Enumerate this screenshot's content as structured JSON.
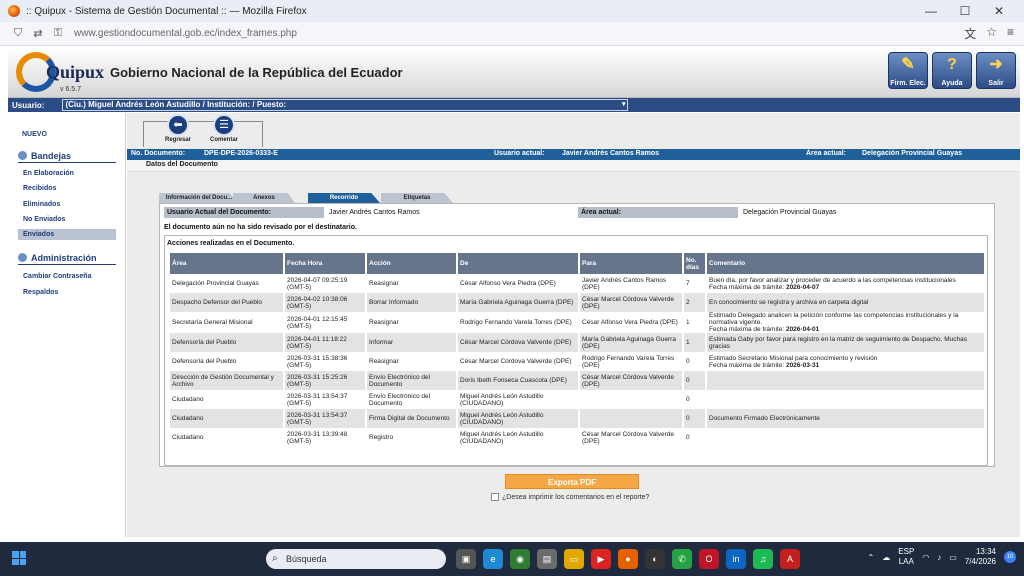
{
  "browser": {
    "title": ":: Quipux - Sistema de Gestión Documental :: — Mozilla Firefox",
    "url": "www.gestiondocumental.gob.ec/index_frames.php"
  },
  "header": {
    "logo_text": "Quipux",
    "version": "v 6.5.7",
    "gov_title": "Gobierno Nacional de la República del Ecuador",
    "buttons": [
      "Firm. Elec.",
      "Ayuda",
      "Salir"
    ]
  },
  "userbar": {
    "label": "Usuario:",
    "value": "(Ciu.) Miguel Andrés León Astudillo / Institución: / Puesto:"
  },
  "sidebar": {
    "nuevo": "NUEVO",
    "bandejas": "Bandejas",
    "items": [
      "En Elaboración",
      "Recibidos",
      "Eliminados",
      "No Enviados",
      "Enviados"
    ],
    "administracion": "Administración",
    "admin_items": [
      "Cambiar Contraseña",
      "Respaldos"
    ]
  },
  "toolbar": {
    "regresar": "Regresar",
    "comentar": "Comentar"
  },
  "infobar": {
    "doc_label": "No. Documento:",
    "doc_value": "DPE-DPE-2026-0333-E",
    "user_label": "Usuario actual:",
    "user_value": "Javier Andrés Cantos Ramos",
    "area_label": "Área actual:",
    "area_value": "Delegación Provincial Guayas"
  },
  "datos_title": "Datos del Documento",
  "tabs": [
    "Información del Docu...",
    "Anexos",
    "Recorrido",
    "Etiquetas"
  ],
  "current": {
    "user_label": "Usuario Actual del Documento:",
    "user_value": "Javier Andrés Cantos Ramos",
    "area_label": "Área actual:",
    "area_value": "Delegación Provincial Guayas"
  },
  "not_reviewed": "El documento aún no ha sido revisado por el destinatario.",
  "actions_title": "Acciones realizadas en el Documento.",
  "columns": [
    "Área",
    "Fecha Hora",
    "Acción",
    "De",
    "Para",
    "No. días",
    "Comentario"
  ],
  "rows": [
    [
      "Delegación Provincial Guayas",
      "2026-04-07 09:25:19 (GMT-5)",
      "Reasignar",
      "César Alfonso Vera Piedra (DPE)",
      "Javier Andrés Cantos Ramos (DPE)",
      "7",
      "Buen día, por favor analizar y proceder de acuerdo a las competencias institucionales",
      "Fecha máxima de trámite: ",
      "2026-04-07"
    ],
    [
      "Despacho Defensor del Pueblo",
      "2026-04-02 10:38:06 (GMT-5)",
      "Borrar Informado",
      "María Gabriela Aguinaga Guerra (DPE)",
      "César Marcel Córdova Valverde (DPE)",
      "2",
      "En conocimiento se registra y archiva en carpeta digital",
      "",
      ""
    ],
    [
      "Secretaría General Misional",
      "2026-04-01 12:15:45 (GMT-5)",
      "Reasignar",
      "Rodrigo Fernando Varela Torres (DPE)",
      "César Alfonso Vera Piedra (DPE)",
      "1",
      "Estimado Delegado analicen la petición conforme las competencias institucionales y la normativa vigente.",
      "Fecha máxima de trámite: ",
      "2026-04-01"
    ],
    [
      "Defensoría del Pueblo",
      "2026-04-01 11:18:22 (GMT-5)",
      "Informar",
      "César Marcel Córdova Valverde (DPE)",
      "María Gabriela Aguinaga Guerra (DPE)",
      "1",
      "Estimada Gaby por favor para registro en la matriz de seguimiento de Despacho. Muchas gracias",
      "",
      ""
    ],
    [
      "Defensoría del Pueblo",
      "2026-03-31 15:38:36 (GMT-5)",
      "Reasignar",
      "César Marcel Córdova Valverde (DPE)",
      "Rodrigo Fernando Varela Torres (DPE)",
      "0",
      "Estimado Secretario Misional para conocimiento y revisión",
      "Fecha máxima de trámite: ",
      "2026-03-31"
    ],
    [
      "Dirección de Gestión Documental y Archivo",
      "2026-03-31 15:25:26 (GMT-5)",
      "Envío Electrónico del Documento",
      "Doris Ibeth Fonseca Cuascota (DPE)",
      "César Marcel Córdova Valverde (DPE)",
      "0",
      "",
      "",
      ""
    ],
    [
      "Ciudadano",
      "2026-03-31 13:54:37 (GMT-5)",
      "Envío Electrónico del Documento",
      "Miguel Andrés León Astudillo (CIUDADANO)",
      "",
      "0",
      "",
      "",
      ""
    ],
    [
      "Ciudadano",
      "2026-03-31 13:54:37 (GMT-5)",
      "Firma Digital de Documento",
      "Miguel Andrés León Astudillo (CIUDADANO)",
      "",
      "0",
      "Documento Firmado Electrónicamente",
      "",
      ""
    ],
    [
      "Ciudadano",
      "2026-03-31 13:39:48 (GMT-5)",
      "Registro",
      "Miguel Andrés León Astudillo (CIUDADANO)",
      "César Marcel Córdova Valverde (DPE)",
      "0",
      "",
      "",
      ""
    ]
  ],
  "export_label": "Exporta PDF",
  "print_comments": "¿Desea imprimir los comentarios en el reporte?",
  "taskbar": {
    "search": "Búsqueda",
    "lang1": "ESP",
    "lang2": "LAA",
    "time": "13:34",
    "date": "7/4/2026",
    "notif": "10"
  }
}
